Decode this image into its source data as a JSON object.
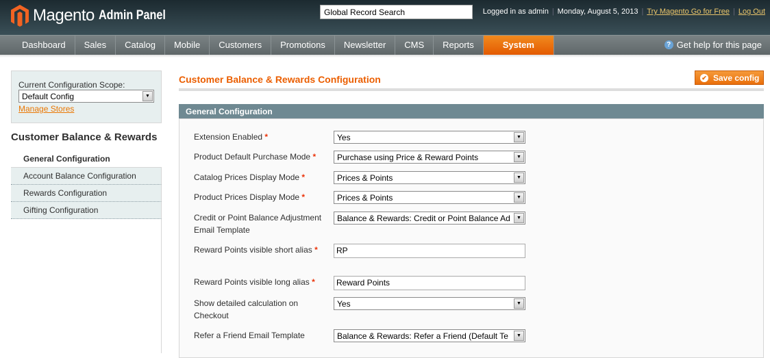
{
  "header": {
    "logo_brand": "Magento",
    "logo_sub": "Admin Panel",
    "search_value": "Global Record Search",
    "logged_in": "Logged in as admin",
    "date": "Monday, August 5, 2013",
    "try_link": "Try Magento Go for Free",
    "logout": "Log Out"
  },
  "nav": {
    "items": [
      "Dashboard",
      "Sales",
      "Catalog",
      "Mobile",
      "Customers",
      "Promotions",
      "Newsletter",
      "CMS",
      "Reports",
      "System"
    ],
    "active": "System",
    "help": "Get help for this page"
  },
  "sidebar": {
    "scope_label": "Current Configuration Scope:",
    "scope_value": "Default Config",
    "manage_stores": "Manage Stores",
    "heading": "Customer Balance & Rewards",
    "items": [
      {
        "label": "General Configuration"
      },
      {
        "label": "Account Balance Configuration"
      },
      {
        "label": "Rewards Configuration"
      },
      {
        "label": "Gifting Configuration"
      }
    ]
  },
  "main": {
    "title": "Customer Balance & Rewards Configuration",
    "save_label": "Save config",
    "section": "General Configuration",
    "fields": [
      {
        "label": "Extension Enabled",
        "required": "*",
        "value": "Yes",
        "type": "select"
      },
      {
        "label": "Product Default Purchase Mode",
        "required": "*",
        "value": "Purchase using Price & Reward Points",
        "type": "select"
      },
      {
        "label": "Catalog Prices Display Mode",
        "required": "*",
        "value": "Prices & Points",
        "type": "select"
      },
      {
        "label": "Product Prices Display Mode",
        "required": "*",
        "value": "Prices & Points",
        "type": "select"
      },
      {
        "label": "Credit or Point Balance Adjustment Email Template",
        "required": "",
        "value": "Balance & Rewards: Credit or Point Balance Ad",
        "type": "select"
      },
      {
        "label": "Reward Points visible short alias",
        "required": "*",
        "value": "RP",
        "type": "text"
      },
      {
        "label": "Reward Points visible long alias",
        "required": "*",
        "value": "Reward Points",
        "type": "text"
      },
      {
        "label": "Show detailed calculation on Checkout",
        "required": "",
        "value": "Yes",
        "type": "select"
      },
      {
        "label": "Refer a Friend Email Template",
        "required": "",
        "value": "Balance & Rewards: Refer a Friend (Default Te",
        "type": "select"
      }
    ]
  },
  "colors": {
    "accent": "#eb5e00",
    "section_header": "#6f8992",
    "nav_active": "#e35a00"
  }
}
